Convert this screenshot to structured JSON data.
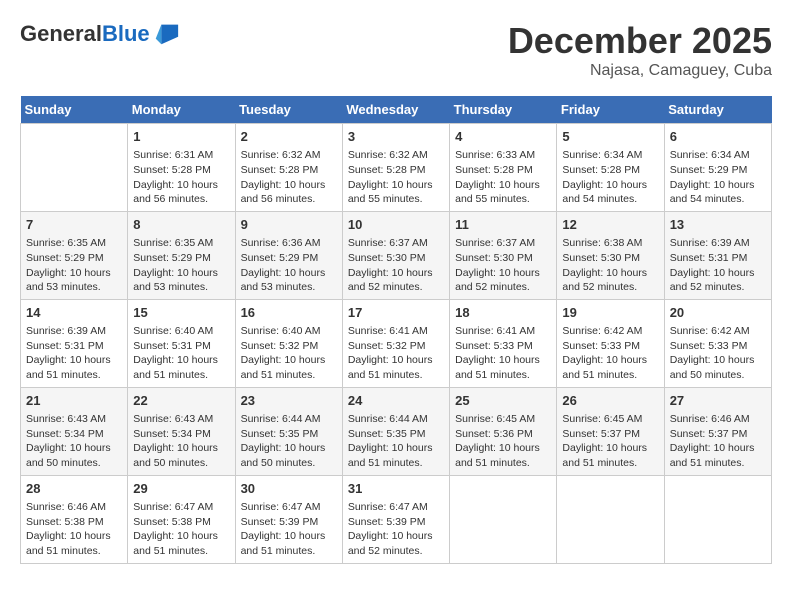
{
  "header": {
    "logo": {
      "line1": "General",
      "line2": "Blue"
    },
    "month": "December 2025",
    "location": "Najasa, Camaguey, Cuba"
  },
  "weekdays": [
    "Sunday",
    "Monday",
    "Tuesday",
    "Wednesday",
    "Thursday",
    "Friday",
    "Saturday"
  ],
  "weeks": [
    [
      {
        "day": "",
        "info": ""
      },
      {
        "day": "1",
        "info": "Sunrise: 6:31 AM\nSunset: 5:28 PM\nDaylight: 10 hours and 56 minutes."
      },
      {
        "day": "2",
        "info": "Sunrise: 6:32 AM\nSunset: 5:28 PM\nDaylight: 10 hours and 56 minutes."
      },
      {
        "day": "3",
        "info": "Sunrise: 6:32 AM\nSunset: 5:28 PM\nDaylight: 10 hours and 55 minutes."
      },
      {
        "day": "4",
        "info": "Sunrise: 6:33 AM\nSunset: 5:28 PM\nDaylight: 10 hours and 55 minutes."
      },
      {
        "day": "5",
        "info": "Sunrise: 6:34 AM\nSunset: 5:28 PM\nDaylight: 10 hours and 54 minutes."
      },
      {
        "day": "6",
        "info": "Sunrise: 6:34 AM\nSunset: 5:29 PM\nDaylight: 10 hours and 54 minutes."
      }
    ],
    [
      {
        "day": "7",
        "info": "Sunrise: 6:35 AM\nSunset: 5:29 PM\nDaylight: 10 hours and 53 minutes."
      },
      {
        "day": "8",
        "info": "Sunrise: 6:35 AM\nSunset: 5:29 PM\nDaylight: 10 hours and 53 minutes."
      },
      {
        "day": "9",
        "info": "Sunrise: 6:36 AM\nSunset: 5:29 PM\nDaylight: 10 hours and 53 minutes."
      },
      {
        "day": "10",
        "info": "Sunrise: 6:37 AM\nSunset: 5:30 PM\nDaylight: 10 hours and 52 minutes."
      },
      {
        "day": "11",
        "info": "Sunrise: 6:37 AM\nSunset: 5:30 PM\nDaylight: 10 hours and 52 minutes."
      },
      {
        "day": "12",
        "info": "Sunrise: 6:38 AM\nSunset: 5:30 PM\nDaylight: 10 hours and 52 minutes."
      },
      {
        "day": "13",
        "info": "Sunrise: 6:39 AM\nSunset: 5:31 PM\nDaylight: 10 hours and 52 minutes."
      }
    ],
    [
      {
        "day": "14",
        "info": "Sunrise: 6:39 AM\nSunset: 5:31 PM\nDaylight: 10 hours and 51 minutes."
      },
      {
        "day": "15",
        "info": "Sunrise: 6:40 AM\nSunset: 5:31 PM\nDaylight: 10 hours and 51 minutes."
      },
      {
        "day": "16",
        "info": "Sunrise: 6:40 AM\nSunset: 5:32 PM\nDaylight: 10 hours and 51 minutes."
      },
      {
        "day": "17",
        "info": "Sunrise: 6:41 AM\nSunset: 5:32 PM\nDaylight: 10 hours and 51 minutes."
      },
      {
        "day": "18",
        "info": "Sunrise: 6:41 AM\nSunset: 5:33 PM\nDaylight: 10 hours and 51 minutes."
      },
      {
        "day": "19",
        "info": "Sunrise: 6:42 AM\nSunset: 5:33 PM\nDaylight: 10 hours and 51 minutes."
      },
      {
        "day": "20",
        "info": "Sunrise: 6:42 AM\nSunset: 5:33 PM\nDaylight: 10 hours and 50 minutes."
      }
    ],
    [
      {
        "day": "21",
        "info": "Sunrise: 6:43 AM\nSunset: 5:34 PM\nDaylight: 10 hours and 50 minutes."
      },
      {
        "day": "22",
        "info": "Sunrise: 6:43 AM\nSunset: 5:34 PM\nDaylight: 10 hours and 50 minutes."
      },
      {
        "day": "23",
        "info": "Sunrise: 6:44 AM\nSunset: 5:35 PM\nDaylight: 10 hours and 50 minutes."
      },
      {
        "day": "24",
        "info": "Sunrise: 6:44 AM\nSunset: 5:35 PM\nDaylight: 10 hours and 51 minutes."
      },
      {
        "day": "25",
        "info": "Sunrise: 6:45 AM\nSunset: 5:36 PM\nDaylight: 10 hours and 51 minutes."
      },
      {
        "day": "26",
        "info": "Sunrise: 6:45 AM\nSunset: 5:37 PM\nDaylight: 10 hours and 51 minutes."
      },
      {
        "day": "27",
        "info": "Sunrise: 6:46 AM\nSunset: 5:37 PM\nDaylight: 10 hours and 51 minutes."
      }
    ],
    [
      {
        "day": "28",
        "info": "Sunrise: 6:46 AM\nSunset: 5:38 PM\nDaylight: 10 hours and 51 minutes."
      },
      {
        "day": "29",
        "info": "Sunrise: 6:47 AM\nSunset: 5:38 PM\nDaylight: 10 hours and 51 minutes."
      },
      {
        "day": "30",
        "info": "Sunrise: 6:47 AM\nSunset: 5:39 PM\nDaylight: 10 hours and 51 minutes."
      },
      {
        "day": "31",
        "info": "Sunrise: 6:47 AM\nSunset: 5:39 PM\nDaylight: 10 hours and 52 minutes."
      },
      {
        "day": "",
        "info": ""
      },
      {
        "day": "",
        "info": ""
      },
      {
        "day": "",
        "info": ""
      }
    ]
  ]
}
